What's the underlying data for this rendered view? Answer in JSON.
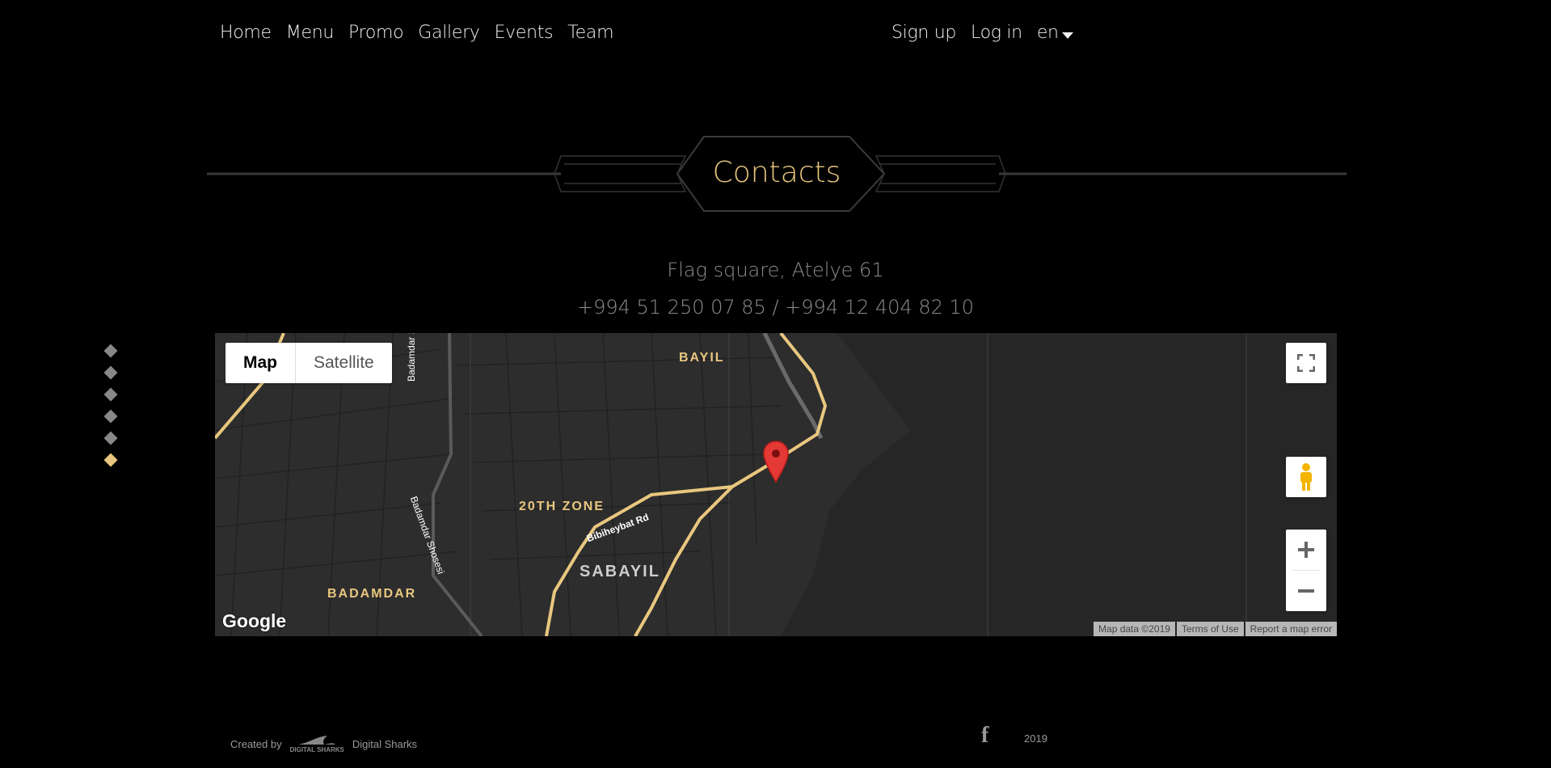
{
  "nav": {
    "left": [
      "Home",
      "Menu",
      "Promo",
      "Gallery",
      "Events",
      "Team"
    ],
    "signup": "Sign up",
    "login": "Log in",
    "lang": "en"
  },
  "section": {
    "title": "Contacts",
    "address": "Flag square, Atelye 61",
    "phones": "+994 51 250 07 85 / +994 12 404 82 10"
  },
  "side_dots": {
    "count": 6,
    "active_index": 5
  },
  "map": {
    "type_map": "Map",
    "type_satellite": "Satellite",
    "labels": {
      "bayil": "BAYIL",
      "zone20": "20TH ZONE",
      "sabayil": "SABAYIL",
      "badamdar": "BADAMDAR"
    },
    "roads": {
      "badamdar1": "Badamdar Shosesi",
      "badamdar2": "Badamdar Shosesi",
      "bibiheybat": "Bibiheybat Rd"
    },
    "google": "Google",
    "attribution": {
      "data": "Map data ©2019",
      "terms": "Terms of Use",
      "report": "Report a map error"
    },
    "colors": {
      "label_gold": "#e9c77f",
      "road_gold": "#e9c77f",
      "marker": "#e53935"
    }
  },
  "footer": {
    "created_by": "Created by",
    "logo_text": "DIGITAL SHARKS",
    "company": "Digital Sharks",
    "facebook_icon": "facebook-icon",
    "year": "2019"
  }
}
